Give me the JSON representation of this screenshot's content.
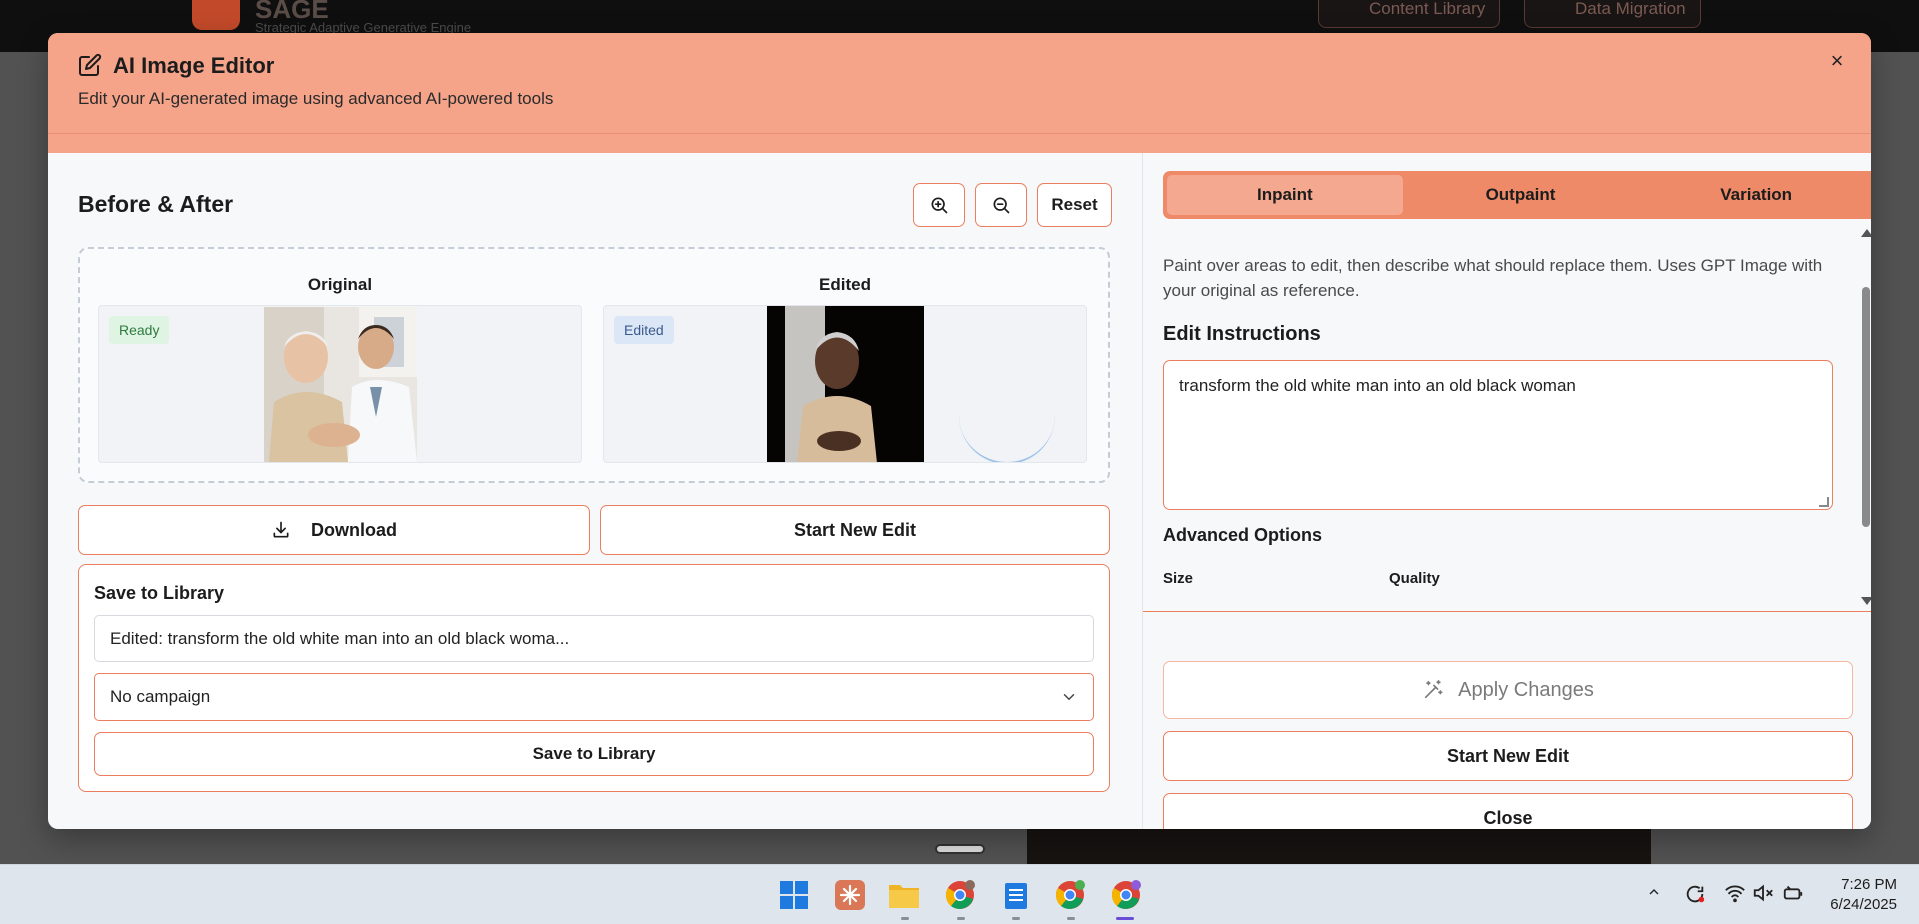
{
  "background": {
    "app_title": "SAGE",
    "app_subtitle": "Strategic Adaptive Generative Engine",
    "nav_buttons": [
      "Content Library",
      "Data Migration"
    ]
  },
  "modal": {
    "title": "AI Image Editor",
    "subtitle": "Edit your AI-generated image using advanced AI-powered tools",
    "close_icon": "×"
  },
  "compare": {
    "title": "Before & After",
    "zoom_in_icon": "zoom-in-icon",
    "zoom_out_icon": "zoom-out-icon",
    "reset_label": "Reset",
    "original_label": "Original",
    "edited_label": "Edited",
    "original_badge": "Ready",
    "edited_badge": "Edited"
  },
  "actions": {
    "download_label": "Download",
    "start_new_edit_label": "Start New Edit"
  },
  "save_library": {
    "title": "Save to Library",
    "name_value": "Edited: transform the old white man into an old black woma...",
    "campaign_value": "No campaign",
    "save_button": "Save to Library"
  },
  "editor": {
    "tabs": [
      {
        "label": "Inpaint",
        "active": true
      },
      {
        "label": "Outpaint",
        "active": false
      },
      {
        "label": "Variation",
        "active": false
      }
    ],
    "description": "Paint over areas to edit, then describe what should replace them. Uses GPT Image with your original as reference.",
    "instructions_title": "Edit Instructions",
    "instructions_value": "transform the old white man into an old black woman",
    "advanced_title": "Advanced Options",
    "size_label": "Size",
    "quality_label": "Quality",
    "apply_label": "Apply Changes",
    "start_new_edit_label": "Start New Edit",
    "close_label": "Close"
  },
  "colors": {
    "accent": "#ea7e5e",
    "header_bg": "#f5a48a",
    "tab_bar": "#ee8a68",
    "tab_active": "#f5a890"
  },
  "taskbar": {
    "time": "7:26 PM",
    "date": "6/24/2025"
  }
}
